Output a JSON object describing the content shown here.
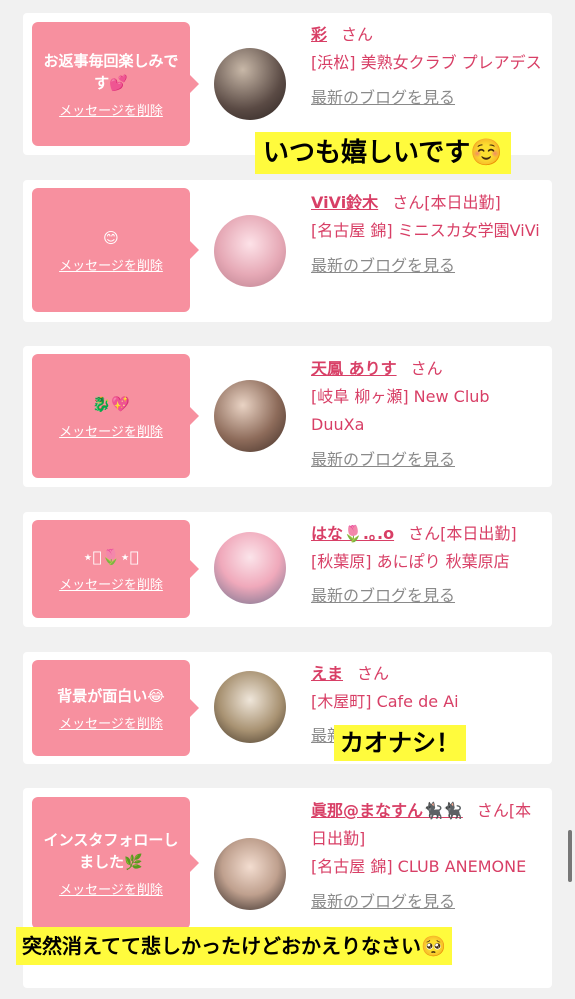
{
  "cards": [
    {
      "message": "お返事毎回楽しみです💕",
      "delete": "メッセージを削除",
      "name": "彩",
      "san": "さん",
      "status": "",
      "shop": "[浜松] 美熟女クラブ プレアデス",
      "blog": "最新のブログを見る"
    },
    {
      "message": "😊",
      "delete": "メッセージを削除",
      "name": "ViVi鈴木",
      "san": "さん",
      "status": "[本日出勤]",
      "shop": "[名古屋 錦] ミニスカ女学園ViVi",
      "blog": "最新のブログを見る"
    },
    {
      "message": "🐉💖",
      "delete": "メッセージを削除",
      "name": "天鳳 ありす",
      "san": "さん",
      "status": "",
      "shop": "[岐阜 柳ヶ瀬] New Club DuuXa",
      "blog": "最新のブログを見る"
    },
    {
      "message": "⋆͛🌷⋆͛",
      "delete": "メッセージを削除",
      "name": "はな🌷.｡.o",
      "san": "さん",
      "status": "[本日出勤]",
      "shop": "[秋葉原] あにぽり 秋葉原店",
      "blog": "最新のブログを見る"
    },
    {
      "message": "背景が面白い😂",
      "delete": "メッセージを削除",
      "name": "えま",
      "san": "さん",
      "status": "",
      "shop": "[木屋町] Cafe de Ai",
      "blog": "最新のブログを見る"
    },
    {
      "message": "インスタフォローしました🌿",
      "delete": "メッセージを削除",
      "name": "眞那@まなすん🐈‍⬛🐈‍⬛",
      "san": "さん",
      "status": "[本日出勤]",
      "shop": "[名古屋 錦] CLUB ANEMONE",
      "blog": "最新のブログを見る"
    }
  ],
  "overlays": {
    "caption1": "いつも嬉しいです☺️",
    "caption2": "カオナシ！",
    "caption3": "突然消えてて悲しかったけどおかえりなさい🥺"
  },
  "colors": {
    "accent": "#d83f66",
    "bubble": "#f7909f",
    "highlight": "#fffb3d"
  }
}
